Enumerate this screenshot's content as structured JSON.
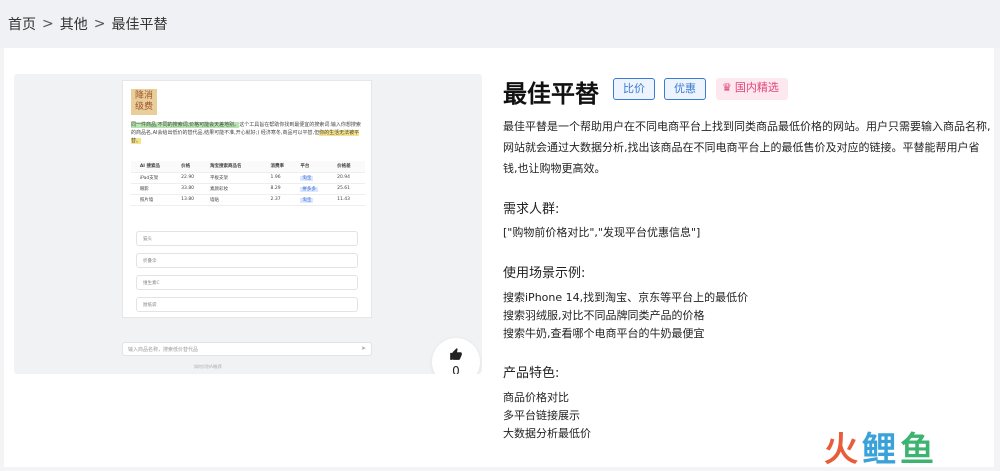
{
  "breadcrumb": [
    "首页",
    "其他",
    "最佳平替"
  ],
  "tool": {
    "title": "最佳平替",
    "tags": [
      "比价",
      "优惠"
    ],
    "badge": "国内精选",
    "intro": "最佳平替是一个帮助用户在不同电商平台上找到同类商品最低价格的网站。用户只需要输入商品名称,网站就会通过大数据分析,找出该商品在不同电商平台上的最低售价及对应的链接。平替能帮用户省钱,也让购物更高效。",
    "audience_heading": "需求人群:",
    "audience": "[\"购物前价格对比\",\"发现平台优惠信息\"]",
    "scenarios_heading": "使用场景示例:",
    "scenarios": [
      "搜索iPhone 14,找到淘宝、京东等平台上的最低价",
      "搜索羽绒服,对比不同品牌同类产品的价格",
      "搜索牛奶,查看哪个电商平台的牛奶最便宜"
    ],
    "features_heading": "产品特色:",
    "features": [
      "商品价格对比",
      "多平台链接展示",
      "大数据分析最低价"
    ],
    "likes": "0"
  },
  "preview": {
    "logo_text": "降消级费",
    "desc_highlight_green": "同一件商品,不同的搜索词,价格可能会天差地别。",
    "desc_rest": "这个工具旨在帮助你找到最便宜的搜索词:输入你想搜索的商品名,AI会给出低价的替代品,结果可能不准,开心就好;) 经济寒冬,商品可以平替,但",
    "desc_highlight_yellow": "你的生活无法被平替。",
    "table_headers": [
      "",
      "AI 搜索品",
      "价格",
      "淘宝搜索商品名",
      "消费率",
      "平台",
      "价格差"
    ],
    "table_rows": [
      [
        "",
        "iPad支架",
        "22.90",
        "平板支架",
        "1.96",
        "淘宝",
        "20.94"
      ],
      [
        "",
        "眼影",
        "33.80",
        "素颜彩妆",
        "8.29",
        "拼多多",
        "25.61"
      ],
      [
        "",
        "照片墙",
        "13.80",
        "墙贴",
        "2.37",
        "淘宝",
        "11.43"
      ]
    ],
    "fields": [
      "猫头",
      "折叠伞",
      "维生素C",
      "厨纸袋"
    ],
    "chat_placeholder": "输入商品名称，搜索低价替代品",
    "footer_text": "如何识别AI推荐"
  },
  "brand_logo": "火鲤鱼"
}
